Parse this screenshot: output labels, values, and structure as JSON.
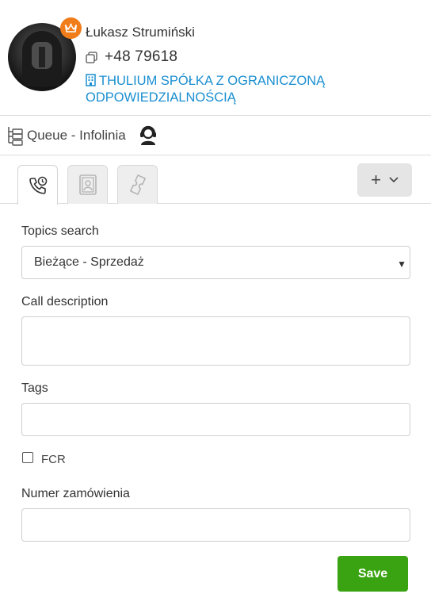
{
  "contact": {
    "name": "Łukasz Strumiński",
    "phone": "+48 79618",
    "company": "THULIUM SPÓŁKA Z OGRANICZONĄ ODPOWIEDZIALNOŚCIĄ"
  },
  "queue": {
    "label": "Queue - Infolinia"
  },
  "tabs": [
    {
      "icon": "phone-call-icon",
      "active": true
    },
    {
      "icon": "contact-card-icon",
      "active": false
    },
    {
      "icon": "ticket-icon",
      "active": false
    }
  ],
  "add_button": {
    "plus": "+"
  },
  "form": {
    "topics_label": "Topics search",
    "topics_value": "Bieżące - Sprzedaż",
    "call_description_label": "Call description",
    "call_description_value": "",
    "tags_label": "Tags",
    "tags_value": "",
    "fcr_label": "FCR",
    "fcr_checked": false,
    "order_number_label": "Numer zamówienia",
    "order_number_value": ""
  },
  "save_label": "Save",
  "colors": {
    "link": "#1a8fd1",
    "badge": "#f07c1a",
    "save": "#3aa311"
  }
}
